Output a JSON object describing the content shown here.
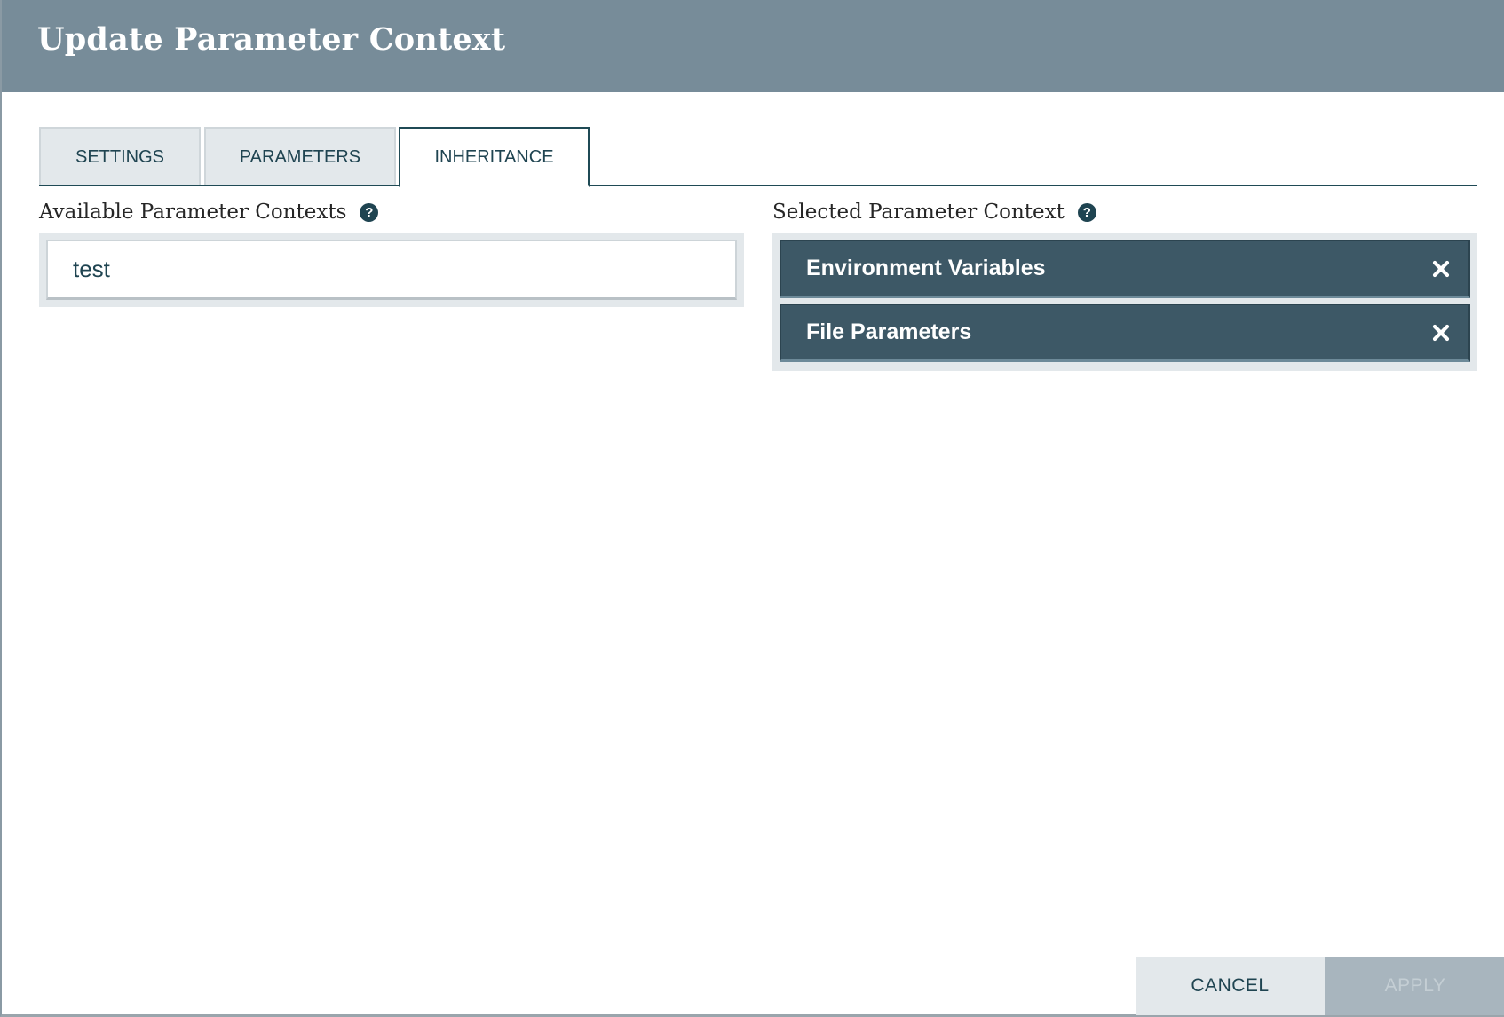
{
  "dialog": {
    "title": "Update Parameter Context"
  },
  "tabs": [
    {
      "label": "SETTINGS",
      "active": false
    },
    {
      "label": "PARAMETERS",
      "active": false
    },
    {
      "label": "INHERITANCE",
      "active": true
    }
  ],
  "available": {
    "label": "Available Parameter Contexts",
    "help_icon": "question-circle-icon",
    "items": [
      "test"
    ]
  },
  "selected": {
    "label": "Selected Parameter Context",
    "help_icon": "question-circle-icon",
    "items": [
      "Environment Variables",
      "File Parameters"
    ],
    "remove_icon": "close-x-icon"
  },
  "buttons": {
    "cancel": "CANCEL",
    "apply": "APPLY",
    "apply_enabled": false
  },
  "colors": {
    "header_bg": "#778c99",
    "primary_dark": "#1f4451",
    "selected_item_bg": "#3d5866",
    "panel_bg": "#e3e8eb",
    "apply_disabled_bg": "#a8b5be"
  }
}
